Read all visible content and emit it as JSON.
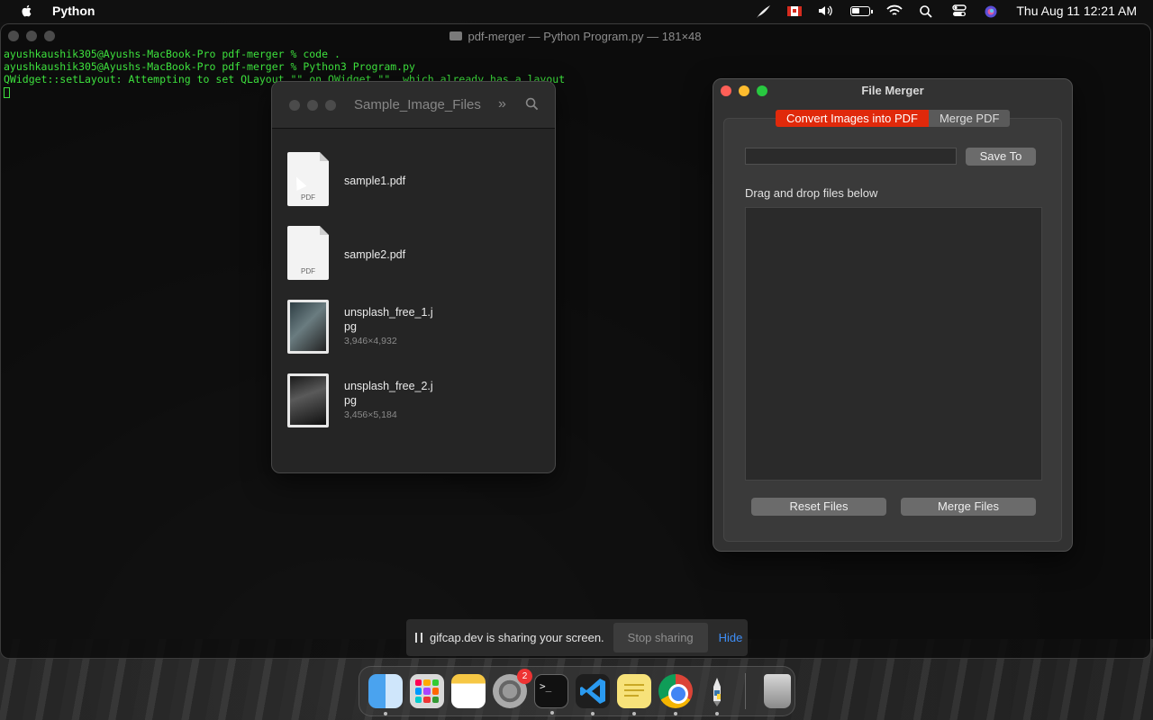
{
  "menubar": {
    "app_name": "Python",
    "datetime": "Thu Aug 11  12:21 AM"
  },
  "terminal": {
    "title": "pdf-merger — Python Program.py — 181×48",
    "lines": [
      "ayushkaushik305@Ayushs-MacBook-Pro pdf-merger % code .",
      "ayushkaushik305@Ayushs-MacBook-Pro pdf-merger % Python3 Program.py",
      "QWidget::setLayout: Attempting to set QLayout \"\" on QWidget \"\", which already has a layout"
    ]
  },
  "finder": {
    "title": "Sample_Image_Files",
    "chevron": "»",
    "files": [
      {
        "name": "sample1.pdf",
        "tag": "PDF"
      },
      {
        "name": "sample2.pdf",
        "tag": "PDF"
      },
      {
        "name": "unsplash_free_1.jpg",
        "name_line1": "unsplash_free_1.j",
        "name_line2": "pg",
        "dimensions": "3,946×4,932"
      },
      {
        "name": "unsplash_free_2.jpg",
        "name_line1": "unsplash_free_2.j",
        "name_line2": "pg",
        "dimensions": "3,456×5,184"
      }
    ]
  },
  "merger": {
    "title": "File Merger",
    "tabs": [
      {
        "label": "Convert Images into PDF",
        "active": true
      },
      {
        "label": "Merge PDF",
        "active": false
      }
    ],
    "path_value": "",
    "save_to_label": "Save To",
    "drag_drop_label": "Drag and drop files below",
    "reset_label": "Reset Files",
    "merge_label": "Merge Files",
    "accent_color": "#e0290b"
  },
  "share_banner": {
    "message": "gifcap.dev is sharing your screen.",
    "stop_label": "Stop sharing",
    "hide_label": "Hide"
  },
  "dock": {
    "settings_badge": "2",
    "terminal_glyph": ">_",
    "apps": [
      "finder-icon",
      "launchpad-icon",
      "notes-icon",
      "system-settings-icon",
      "terminal-icon",
      "vscode-icon",
      "stickies-icon",
      "chrome-icon",
      "python-launcher-icon",
      "trash-icon"
    ]
  }
}
